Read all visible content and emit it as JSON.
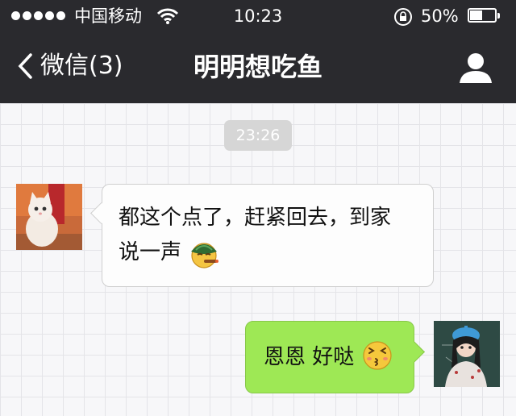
{
  "status_bar": {
    "carrier": "中国移动",
    "time": "10:23",
    "battery": "50%",
    "battery_level": 0.5,
    "signal_dots": 5
  },
  "nav": {
    "back_label": "微信(3)",
    "title": "明明想吃鱼",
    "back_icon": "chevron-left-icon",
    "profile_icon": "person-icon"
  },
  "chat": {
    "timestamp": "23:26",
    "messages": [
      {
        "side": "left",
        "line1": "都这个点了，赶紧回去，到家",
        "line2": "说一声",
        "emoji": "cigar-emoji",
        "avatar": "white-cat-avatar"
      },
      {
        "side": "right",
        "text": "恩恩 好哒",
        "emoji": "kiss-emoji",
        "avatar": "girl-avatar"
      }
    ]
  },
  "colors": {
    "header_bg": "#2a2a2e",
    "right_bubble": "#9ee855",
    "left_bubble": "#fdfdfd",
    "chat_bg": "#f7f7f9"
  }
}
